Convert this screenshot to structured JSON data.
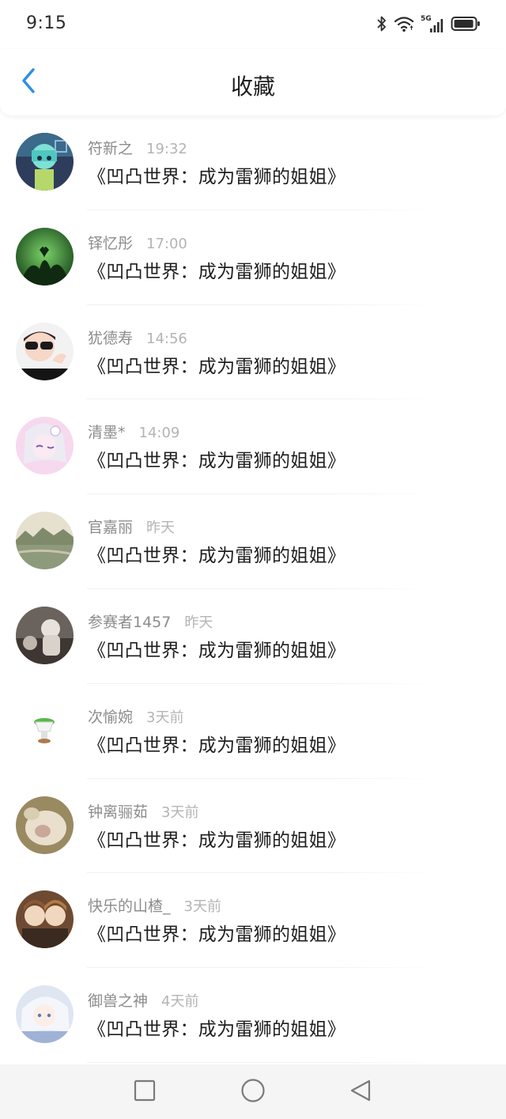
{
  "status_bar": {
    "time": "9:15",
    "icons": [
      "bluetooth-icon",
      "wifi-icon",
      "signal-5g-icon",
      "battery-icon"
    ],
    "signal_label": "5G"
  },
  "header": {
    "title": "收藏",
    "back_icon": "chevron-left-icon",
    "accent_color": "#2f8fe6"
  },
  "favorites": [
    {
      "name": "符新之",
      "time": "19:32",
      "content": "《凹凸世界：成为雷狮的姐姐》",
      "avatar": "anime-teal-avatar"
    },
    {
      "name": "铎忆彤",
      "time": "17:00",
      "content": "《凹凸世界：成为雷狮的姐姐》",
      "avatar": "green-heart-hands-avatar"
    },
    {
      "name": "犹德寿",
      "time": "14:56",
      "content": "《凹凸世界：成为雷狮的姐姐》",
      "avatar": "sunglasses-person-avatar"
    },
    {
      "name": "清墨*",
      "time": "14:09",
      "content": "《凹凸世界：成为雷狮的姐姐》",
      "avatar": "anime-white-hair-avatar"
    },
    {
      "name": "官嘉丽",
      "time": "昨天",
      "content": "《凹凸世界：成为雷狮的姐姐》",
      "avatar": "landscape-avatar"
    },
    {
      "name": "参赛者1457",
      "time": "昨天",
      "content": "《凹凸世界：成为雷狮的姐姐》",
      "avatar": "figurine-avatar"
    },
    {
      "name": "次愉婉",
      "time": "3天前",
      "content": "《凹凸世界：成为雷狮的姐姐》",
      "avatar": "cactus-pot-avatar"
    },
    {
      "name": "钟离骊茹",
      "time": "3天前",
      "content": "《凹凸世界：成为雷狮的姐姐》",
      "avatar": "cat-paw-avatar"
    },
    {
      "name": "快乐的山楂_",
      "time": "3天前",
      "content": "《凹凸世界：成为雷狮的姐姐》",
      "avatar": "anime-duo-avatar"
    },
    {
      "name": "御兽之神",
      "time": "4天前",
      "content": "《凹凸世界：成为雷狮的姐姐》",
      "avatar": "anime-silver-avatar"
    }
  ],
  "nav_bar": {
    "buttons": [
      "recent-apps-icon",
      "home-icon",
      "back-triangle-icon"
    ]
  }
}
